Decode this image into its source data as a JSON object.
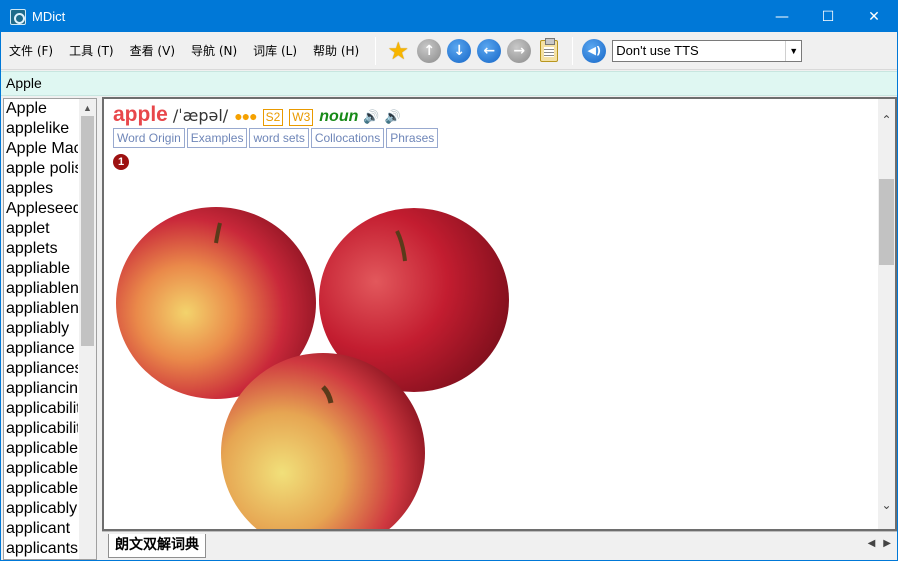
{
  "window": {
    "title": "MDict",
    "controls": {
      "minimize": "—",
      "maximize": "☐",
      "close": "✕"
    }
  },
  "menu": [
    "文件 (F)",
    "工具 (T)",
    "查看 (V)",
    "导航 (N)",
    "词库 (L)",
    "帮助 (H)"
  ],
  "toolbar": {
    "icons": [
      "favorite-star-icon",
      "up-gray-icon",
      "down-blue-icon",
      "back-blue-icon",
      "forward-gray-icon",
      "clipboard-icon",
      "tts-speaker-icon"
    ],
    "tts_option": "Don't use TTS"
  },
  "search": {
    "value": "Apple"
  },
  "wordlist": [
    "Apple",
    "applelike",
    "Apple Mac",
    "apple polisher",
    "apples",
    "Appleseed",
    "applet",
    "applets",
    "appliable",
    "appliableness",
    "appliableness",
    "appliably",
    "appliance",
    "appliances",
    "appliancing",
    "applicability",
    "applicability",
    "applicable",
    "applicable",
    "applicable",
    "applicably",
    "applicant",
    "applicants"
  ],
  "entry": {
    "headword": "apple",
    "pronunciation": "/ˈæpəl/",
    "frequency": "●●●",
    "level_s": "S2",
    "level_w": "W3",
    "part_of_speech": "noun",
    "tabs": [
      "Word Origin",
      "Examples",
      "word sets",
      "Collocations",
      "Phrases"
    ],
    "sense_number": "1"
  },
  "dictionary_tab": "朗文双解词典",
  "colors": {
    "titlebar": "#0078d7",
    "headword": "#e8474b",
    "pos": "#178a17",
    "tab_link": "#6f86b8",
    "searchbar": "#dff7f2"
  }
}
